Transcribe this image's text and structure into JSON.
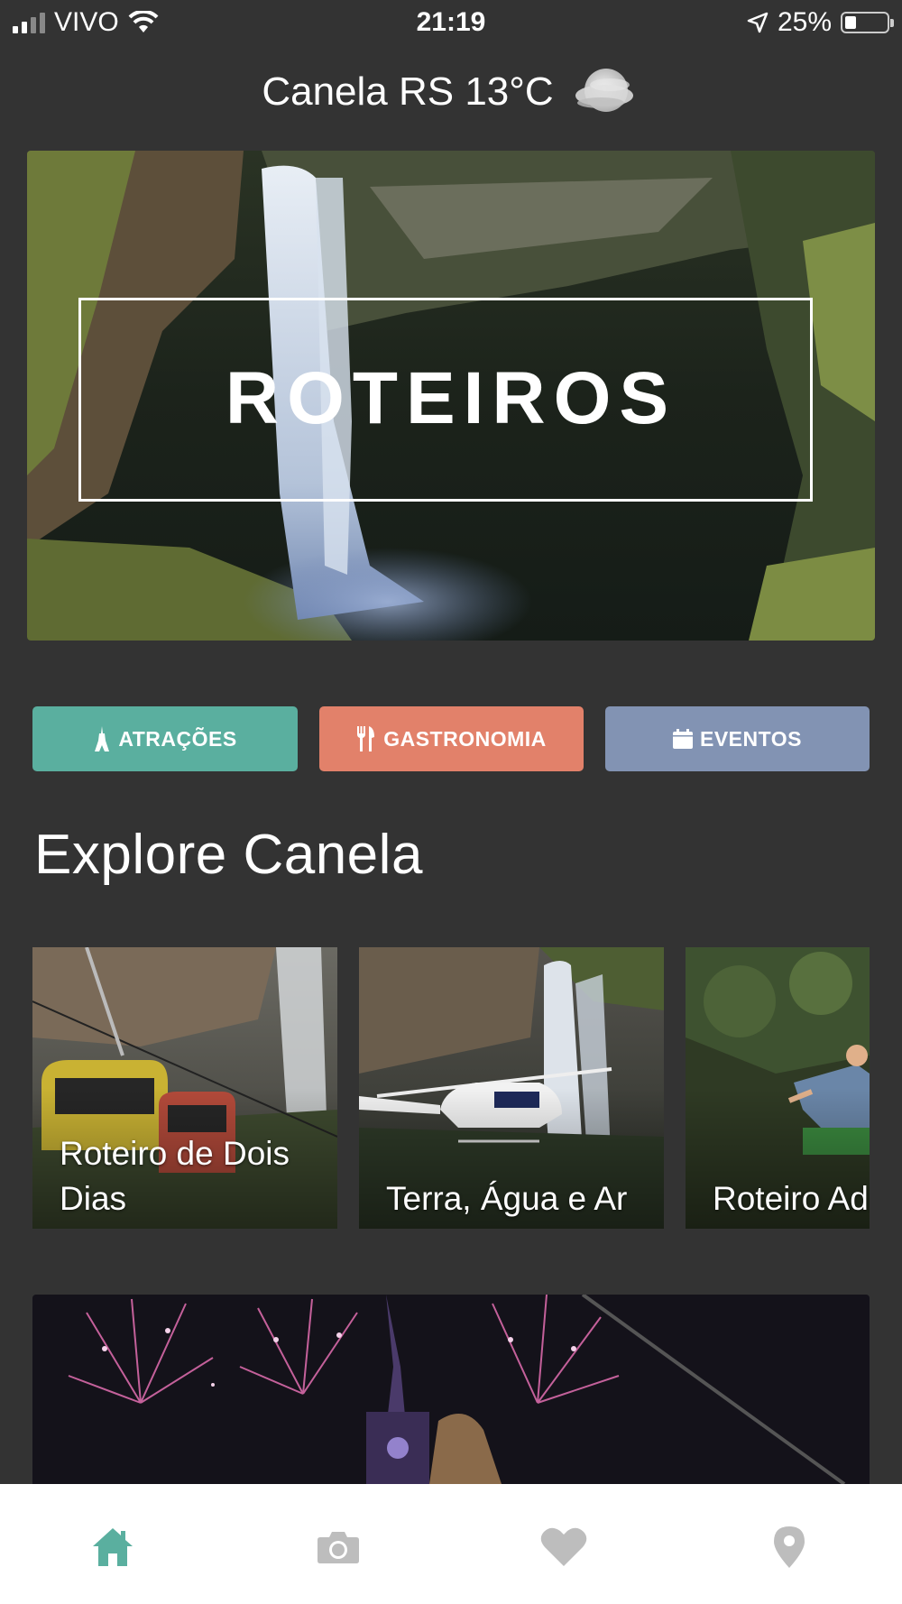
{
  "status_bar": {
    "carrier": "VIVO",
    "time": "21:19",
    "battery": "25%",
    "battery_level": 0.25
  },
  "header": {
    "weather": "Canela RS 13°C",
    "weather_icon": "cloudy-night-icon"
  },
  "hero": {
    "title": "ROTEIROS"
  },
  "categories": [
    {
      "label": "ATRAÇÕES",
      "icon": "tower-icon",
      "color": "#5aaf9f"
    },
    {
      "label": "GASTRONOMIA",
      "icon": "fork-knife-icon",
      "color": "#e2816a"
    },
    {
      "label": "EVENTOS",
      "icon": "calendar-icon",
      "color": "#8293b3"
    }
  ],
  "explore": {
    "title": "Explore Canela",
    "cards": [
      {
        "label": "Roteiro de Dois Dias"
      },
      {
        "label": "Terra, Água e Ar"
      },
      {
        "label": "Roteiro Adrenalina"
      }
    ]
  },
  "tab_bar": {
    "active_color": "#5aaf9f",
    "inactive_color": "#bdbdbd",
    "tabs": [
      "home-icon",
      "camera-icon",
      "heart-icon",
      "map-pin-icon"
    ]
  }
}
